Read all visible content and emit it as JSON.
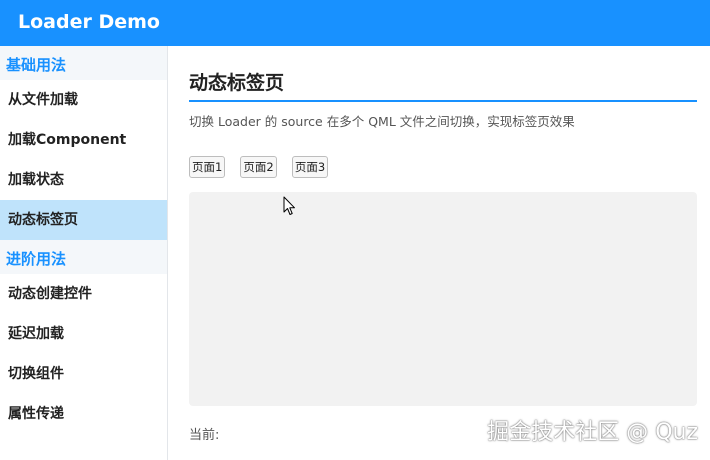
{
  "window": {
    "title": "Loader Demo"
  },
  "sidebar": {
    "sections": [
      {
        "title": "基础用法",
        "items": [
          {
            "label": "从文件加载"
          },
          {
            "label": "加载Component"
          },
          {
            "label": "加载状态"
          },
          {
            "label": "动态标签页",
            "active": true
          }
        ]
      },
      {
        "title": "进阶用法",
        "items": [
          {
            "label": "动态创建控件"
          },
          {
            "label": "延迟加载"
          },
          {
            "label": "切换组件"
          },
          {
            "label": "属性传递"
          }
        ]
      }
    ]
  },
  "main": {
    "title": "动态标签页",
    "description": "切换 Loader 的 source 在多个 QML 文件之间切换，实现标签页效果",
    "tabs": [
      {
        "label": "页面1"
      },
      {
        "label": "页面2"
      },
      {
        "label": "页面3"
      }
    ],
    "current_label": "当前:"
  },
  "watermark": "掘金技术社区 @ Quz",
  "colors": {
    "accent": "#1891ff",
    "active_bg": "#bfe3fb",
    "panel_bg": "#f2f2f2"
  },
  "icons": {
    "cursor": "mouse-pointer-icon"
  }
}
